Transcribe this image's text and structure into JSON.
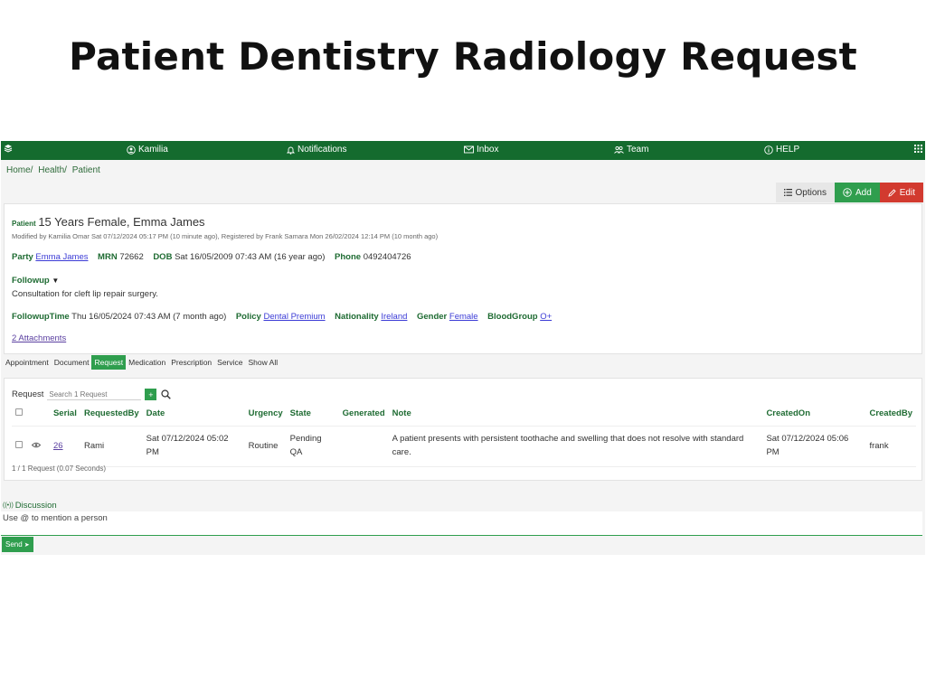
{
  "page": {
    "title": "Patient Dentistry Radiology Request"
  },
  "navbar": {
    "user": "Kamilia",
    "notifications": "Notifications",
    "inbox": "Inbox",
    "team": "Team",
    "help": "HELP",
    "bg_color": "#146b2e"
  },
  "breadcrumb": [
    "Home/",
    "Health/",
    "Patient"
  ],
  "actions": {
    "options": "Options",
    "add": "Add",
    "edit": "Edit"
  },
  "patient": {
    "label": "Patient",
    "name": "15 Years Female, Emma James",
    "meta": "Modified by Kamilia Omar Sat 07/12/2024 05:17 PM (10 minute ago), Registered by Frank Samara Mon 26/02/2024 12:14 PM (10 month ago)",
    "party_label": "Party",
    "party": "Emma James",
    "mrn_label": "MRN",
    "mrn": "72662",
    "dob_label": "DOB",
    "dob": "Sat 16/05/2009 07:43 AM (16 year ago)",
    "phone_label": "Phone",
    "phone": "0492404726",
    "followup_label": "Followup",
    "followup_text": "Consultation for cleft lip repair surgery.",
    "followup_time_label": "FollowupTime",
    "followup_time": "Thu 16/05/2024 07:43 AM (7 month ago)",
    "policy_label": "Policy",
    "policy": "Dental Premium",
    "nationality_label": "Nationality",
    "nationality": "Ireland",
    "gender_label": "Gender",
    "gender": "Female",
    "bloodgroup_label": "BloodGroup",
    "bloodgroup": "O+",
    "attachments": "2 Attachments"
  },
  "tabs": [
    {
      "label": "Appointment",
      "active": false
    },
    {
      "label": "Document",
      "active": false
    },
    {
      "label": "Request",
      "active": true
    },
    {
      "label": "Medication",
      "active": false
    },
    {
      "label": "Prescription",
      "active": false
    },
    {
      "label": "Service",
      "active": false
    },
    {
      "label": "Show All",
      "active": false
    }
  ],
  "requests": {
    "label": "Request",
    "search_placeholder": "Search 1 Request",
    "columns": [
      "Serial",
      "RequestedBy",
      "Date",
      "Urgency",
      "State",
      "Generated",
      "Note",
      "CreatedOn",
      "CreatedBy"
    ],
    "rows": [
      {
        "serial": "26",
        "requested_by": "Rami",
        "date": "Sat 07/12/2024 05:02 PM",
        "urgency": "Routine",
        "state": "Pending QA",
        "generated": "",
        "note": "A patient presents with persistent toothache and swelling that does not resolve with standard care.",
        "created_on": "Sat 07/12/2024 05:06 PM",
        "created_by": "frank"
      }
    ],
    "footer": "1 / 1 Request (0.07 Seconds)"
  },
  "discussion": {
    "title": "Discussion",
    "placeholder": "Use @ to mention a person",
    "send": "Send"
  }
}
